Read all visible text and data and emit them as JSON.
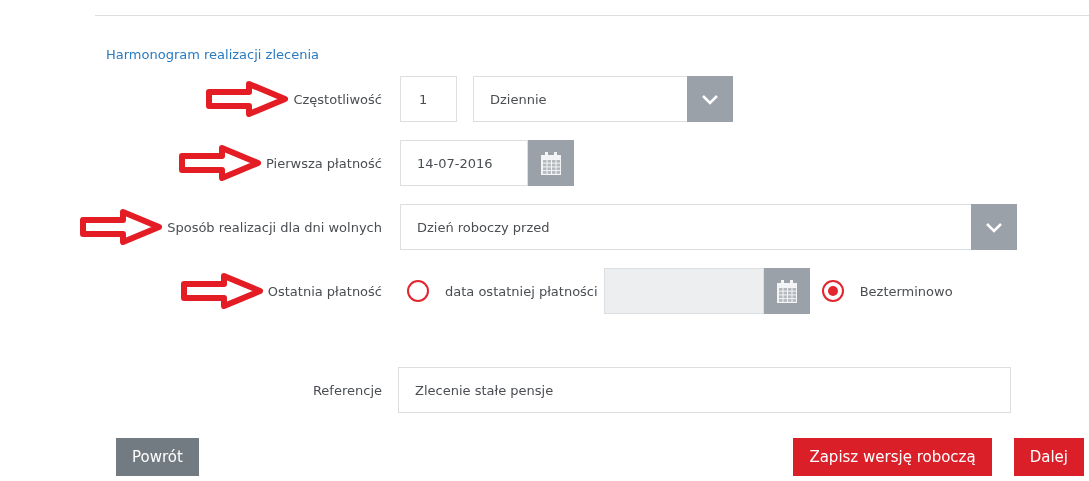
{
  "section_title": "Harmonogram realizacji zlecenia",
  "fields": [
    {
      "kind": "frequency",
      "label": "Częstotliwość",
      "arrow": true,
      "value": "1",
      "select": "Dziennie"
    },
    {
      "kind": "date",
      "label": "Pierwsza płatność",
      "arrow": true,
      "value": "14-07-2016"
    },
    {
      "kind": "select",
      "label": "Sposób realizacji dla dni wolnych",
      "arrow": true,
      "value": "Dzień roboczy przed"
    },
    {
      "kind": "radios",
      "label": "Ostatnia płatność",
      "arrow": true,
      "options": [
        {
          "label": "data ostatniej płatności",
          "selected": false,
          "date_disabled": true
        },
        {
          "label": "Bezterminowo",
          "selected": true
        }
      ]
    },
    {
      "kind": "text",
      "label": "Referencje",
      "arrow": false,
      "value": "Zlecenie stałe pensje"
    }
  ],
  "buttons": [
    {
      "label": "Powrót",
      "kind": "secondary"
    },
    {
      "label": "Zapisz wersję roboczą",
      "kind": "primary"
    },
    {
      "label": "Dalej",
      "kind": "primary"
    }
  ]
}
